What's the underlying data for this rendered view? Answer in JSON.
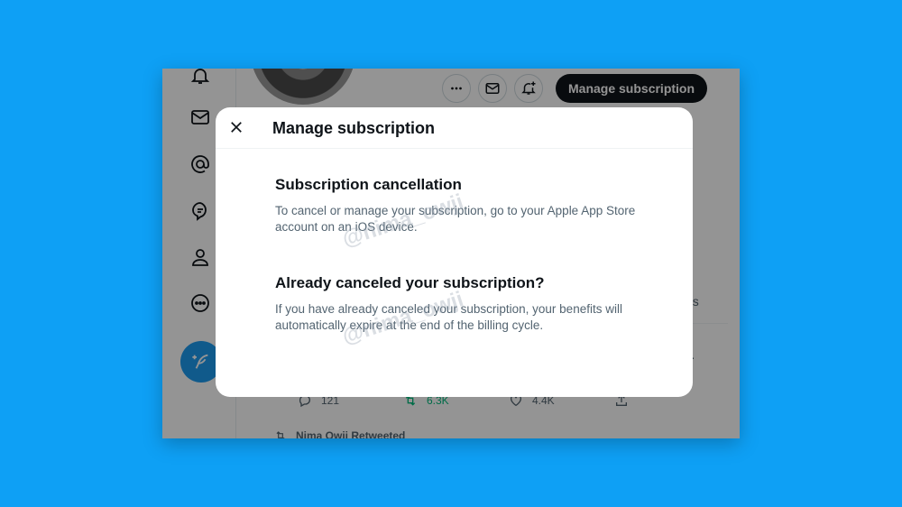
{
  "window": {
    "top_actions": {
      "more_icon": "more-horizontal-icon",
      "message_icon": "mail-icon",
      "notify_icon": "bell-plus-icon",
      "manage_label": "Manage subscription"
    },
    "sidebar_icons": [
      "bell-icon",
      "mail-icon",
      "at-icon",
      "topics-icon",
      "profile-icon",
      "more-circle-icon"
    ],
    "compose_icon": "feather-plus-icon",
    "background_text": {
      "side_snippet": "ns",
      "more_dot": "·"
    },
    "tweet_actions": {
      "replies": "121",
      "retweets": "6.3K",
      "likes": "4.4K"
    },
    "retweeted_label": "Nima Owji Retweeted"
  },
  "modal": {
    "title": "Manage subscription",
    "sections": [
      {
        "heading": "Subscription cancellation",
        "body": "To cancel or manage your subscription, go to your Apple App Store account on an iOS device."
      },
      {
        "heading": "Already canceled your subscription?",
        "body": "If you have already canceled your subscription, your benefits will automatically expire at the end of the billing cycle."
      }
    ],
    "watermark": "@nima_owji"
  },
  "colors": {
    "background": "#0ea0f5",
    "accent": "#1d9bf0",
    "text_primary": "#0f1419",
    "text_secondary": "#536471",
    "retweet_green": "#00ba7c"
  }
}
